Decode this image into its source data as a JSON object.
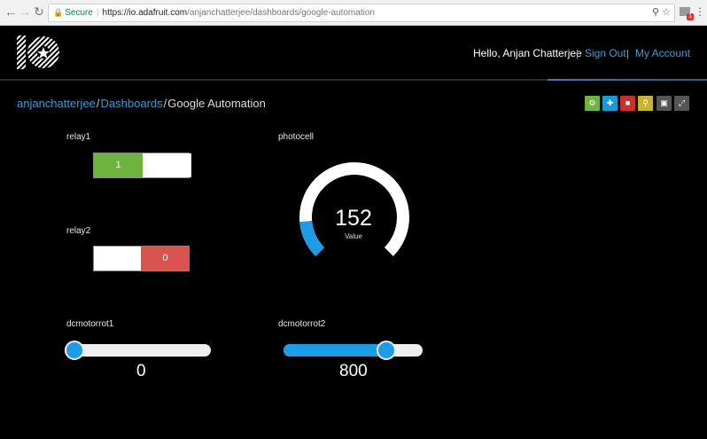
{
  "browser": {
    "secure_label": "Secure",
    "url_host": "https://io.adafruit.com",
    "url_path": "/anjanchatterjee/dashboards/google-automation",
    "ext_badge": "1"
  },
  "header": {
    "greeting": "Hello, Anjan Chatterjee",
    "sign_out": "Sign Out",
    "my_account": "My Account",
    "pipe": "|"
  },
  "breadcrumb": {
    "user": "anjanchatterjee",
    "dashboards": "Dashboards",
    "current": "Google Automation",
    "slash": "/"
  },
  "toolbar": {
    "buttons": [
      {
        "icon": "gear-icon",
        "color": "#6db33f"
      },
      {
        "icon": "plus-icon",
        "color": "#1a9ad6"
      },
      {
        "icon": "trash-icon",
        "color": "#c9302c"
      },
      {
        "icon": "key-icon",
        "color": "#c9b52d"
      },
      {
        "icon": "lock-icon",
        "color": "#555555"
      },
      {
        "icon": "expand-icon",
        "color": "#555555"
      }
    ]
  },
  "blocks": {
    "relay1": {
      "label": "relay1",
      "value": "1",
      "on_color": "#6db33f"
    },
    "relay2": {
      "label": "relay2",
      "value": "0",
      "off_color": "#d9534f"
    },
    "photocell": {
      "label": "photocell",
      "value": "152",
      "caption": "Value",
      "min": 0,
      "max": 1023,
      "fill_fraction": 0.149
    },
    "dcmotorrot1": {
      "label": "dcmotorrot1",
      "value": "0",
      "min": 0,
      "max": 1023,
      "fraction": 0.0
    },
    "dcmotorrot2": {
      "label": "dcmotorrot2",
      "value": "800",
      "min": 0,
      "max": 1023,
      "fraction": 0.78
    }
  },
  "colors": {
    "accent": "#3b9bd9",
    "slider": "#1c9be6",
    "background": "#000000"
  }
}
